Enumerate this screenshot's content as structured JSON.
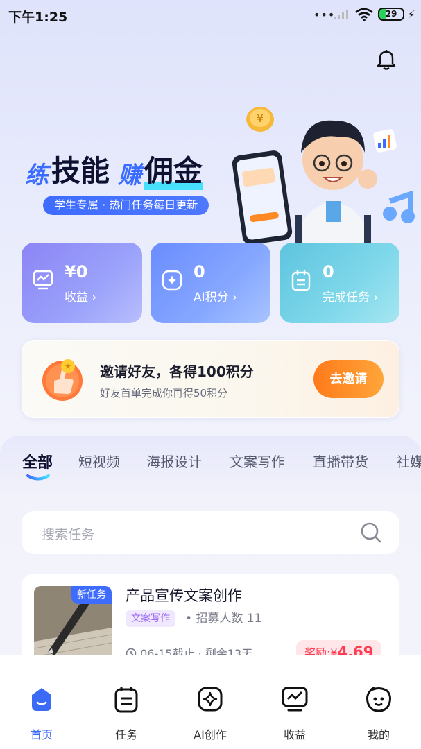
{
  "status_bar": {
    "time": "下午1:25",
    "battery": "29"
  },
  "hero": {
    "title_part1": "练",
    "title_part2": "技能",
    "title_part3": "赚",
    "title_part4": "佣金",
    "subtitle": "学生专属 · 热门任务每日更新"
  },
  "stats": [
    {
      "value": "¥0",
      "label": "收益 ›"
    },
    {
      "value": "0",
      "label": "AI积分 ›"
    },
    {
      "value": "0",
      "label": "完成任务 ›"
    }
  ],
  "invite": {
    "title_prefix": "邀请好友，各得",
    "title_highlight": "100",
    "title_suffix": "积分",
    "desc_prefix": "好友首单完成你再得",
    "desc_highlight": "50",
    "desc_suffix": "积分",
    "button": "去邀请"
  },
  "tabs": [
    "全部",
    "短视频",
    "海报设计",
    "文案写作",
    "直播带货",
    "社媒"
  ],
  "search": {
    "placeholder": "搜索任务"
  },
  "task": {
    "badge": "新任务",
    "title": "产品宣传文案创作",
    "tag": "文案写作",
    "recruit": "• 招募人数 11",
    "deadline": "06-15截止 · 剩余13天",
    "reward_label": "奖励:¥",
    "reward_value": "4.69"
  },
  "nav": [
    "首页",
    "任务",
    "AI创作",
    "收益",
    "我的"
  ],
  "colors": {
    "accent": "#3d6cff",
    "orange": "#ff8a25",
    "reward": "#ff3d52"
  }
}
